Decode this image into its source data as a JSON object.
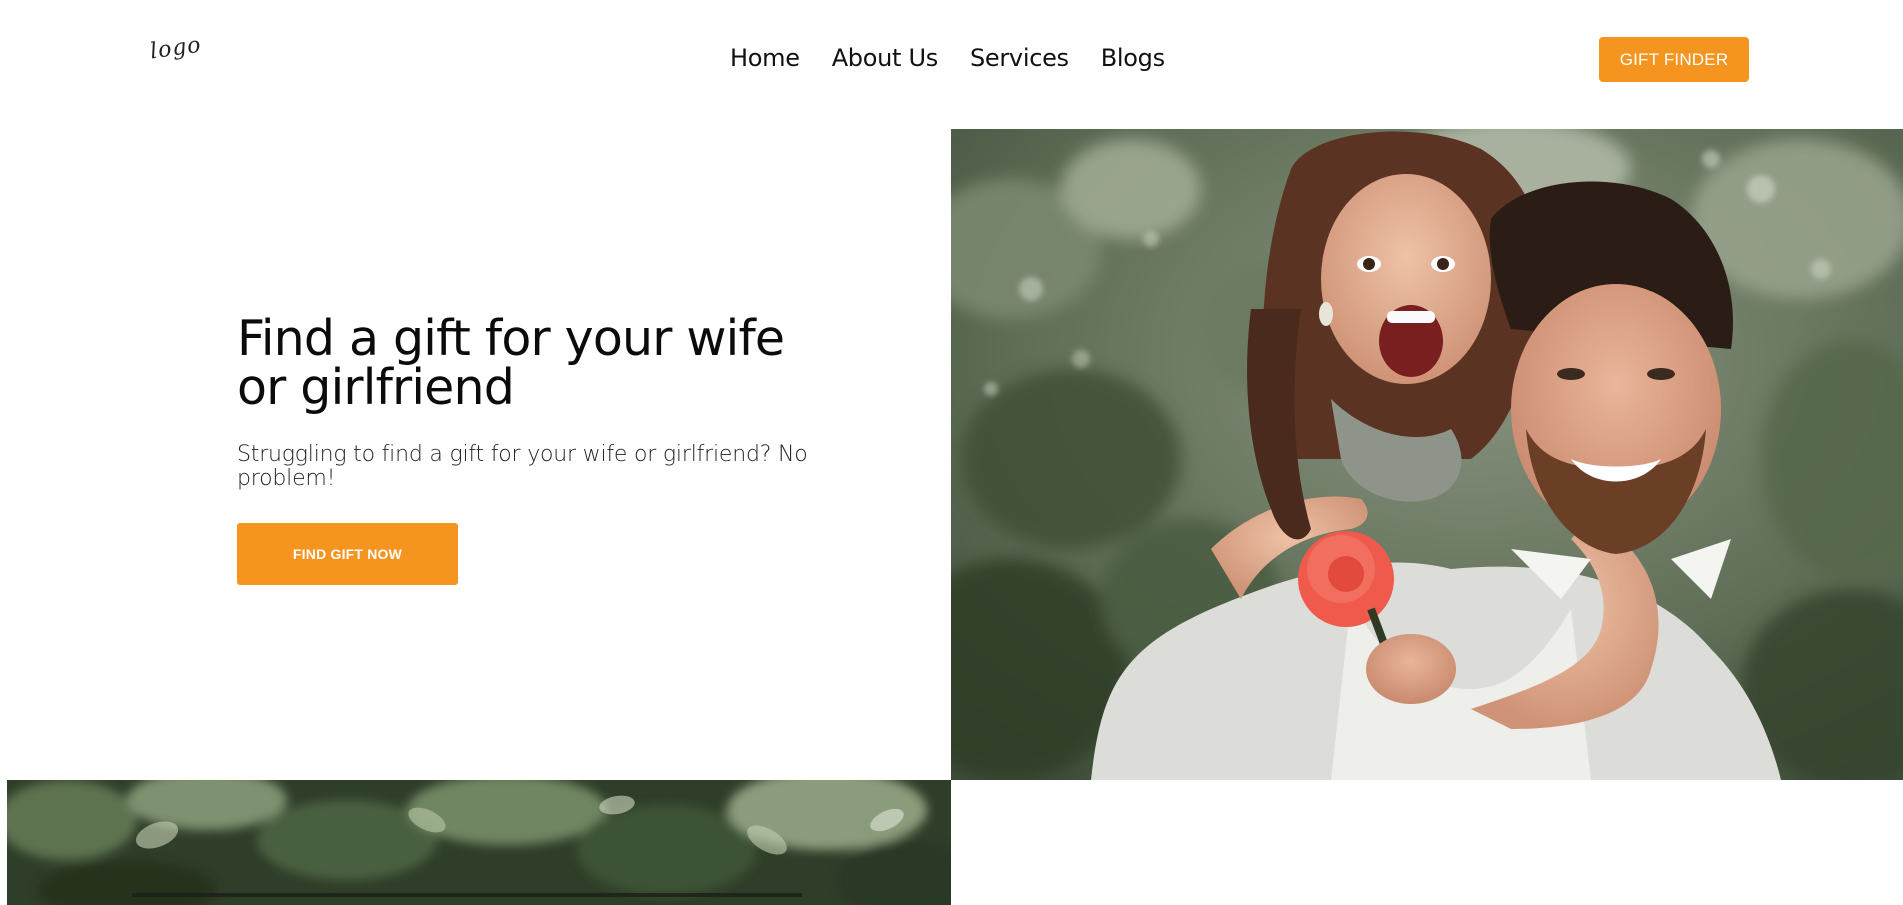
{
  "header": {
    "logo_text": "logo",
    "nav": [
      {
        "label": "Home"
      },
      {
        "label": "About Us"
      },
      {
        "label": "Services"
      },
      {
        "label": "Blogs"
      }
    ],
    "cta_label": "GIFT FINDER"
  },
  "hero": {
    "title": "Find a gift for your wife or girlfriend",
    "subtitle": "Struggling to find a gift for your wife or girlfriend? No problem!",
    "button_label": "FIND GIFT NOW"
  },
  "colors": {
    "accent": "#f5951f",
    "text": "#111111",
    "background": "#ffffff"
  }
}
